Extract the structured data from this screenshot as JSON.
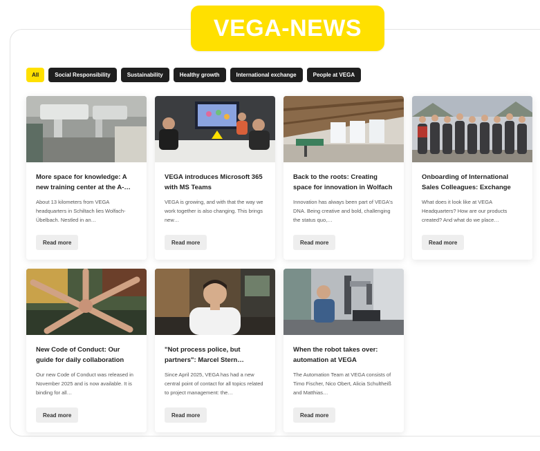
{
  "header": {
    "brand_title": "VEGA-NEWS"
  },
  "filters": [
    {
      "label": "All",
      "active": true
    },
    {
      "label": "Social Responsibility",
      "active": false
    },
    {
      "label": "Sustainability",
      "active": false
    },
    {
      "label": "Healthy growth",
      "active": false
    },
    {
      "label": "International exchange",
      "active": false
    },
    {
      "label": "People at VEGA",
      "active": false
    }
  ],
  "articles": [
    {
      "title": "More space for knowledge: A new training center at the A-…",
      "excerpt": "About 13 kilometers from VEGA headquarters in Schiltach lies Wolfach-Übelbach. Nestled in an…",
      "button": "Read more",
      "image": "training-center-photo"
    },
    {
      "title": "VEGA introduces Microsoft 365 with MS Teams",
      "excerpt": "VEGA is growing, and with that the way we work together is also changing. This brings new…",
      "button": "Read more",
      "image": "meeting-room-photo"
    },
    {
      "title": "Back to the roots: Creating space for innovation in Wolfach",
      "excerpt": "Innovation has always been part of VEGA's DNA. Being creative and bold, challenging the status quo,…",
      "button": "Read more",
      "image": "attic-office-photo"
    },
    {
      "title": "Onboarding of International Sales Colleagues: Exchange an…",
      "excerpt": "What does it look like at VEGA Headquarters? How are our products created? And what do we place…",
      "button": "Read more",
      "image": "group-photo"
    },
    {
      "title": "New Code of Conduct: Our guide for daily collaboration",
      "excerpt": "Our new Code of Conduct was released in November 2025 and is now available. It is binding for all…",
      "button": "Read more",
      "image": "team-hands-photo"
    },
    {
      "title": "\"Not process police, but partners\": Marcel Stern…",
      "excerpt": "Since April 2025, VEGA has had a new central point of contact for all topics related to project management: the…",
      "button": "Read more",
      "image": "portrait-photo"
    },
    {
      "title": "When the robot takes over: automation at VEGA",
      "excerpt": "The Automation Team at VEGA consists of Timo Fischer, Nico Obert, Alicia Schultheiß and Matthias…",
      "button": "Read more",
      "image": "robot-lab-photo"
    }
  ]
}
